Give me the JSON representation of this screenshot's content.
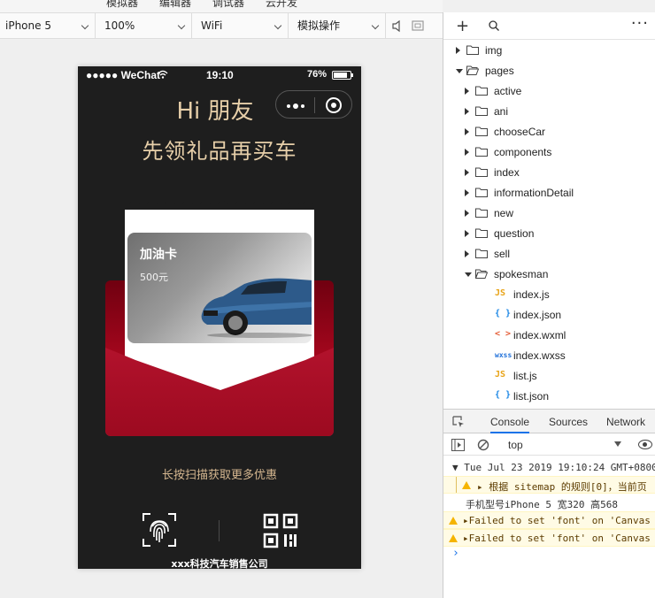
{
  "menu": [
    "模拟器",
    "编辑器",
    "调试器",
    "云开发"
  ],
  "toolbar": {
    "device": "iPhone 5",
    "zoom": "100%",
    "network": "WiFi",
    "operation": "模拟操作"
  },
  "phone": {
    "carrier": "●●●●● WeChat",
    "time": "19:10",
    "battery": "76%",
    "greeting": "Hi 朋友",
    "slogan": "先领礼品再买车",
    "card_title": "加油卡",
    "card_value": "500元",
    "hint": "长按扫描获取更多优惠",
    "company": "xxx科技汽车销售公司"
  },
  "tree": [
    {
      "label": "img",
      "type": "folder",
      "open": false,
      "level": 0
    },
    {
      "label": "pages",
      "type": "folder",
      "open": true,
      "level": 0
    },
    {
      "label": "active",
      "type": "folder",
      "open": false,
      "level": 1
    },
    {
      "label": "ani",
      "type": "folder",
      "open": false,
      "level": 1
    },
    {
      "label": "chooseCar",
      "type": "folder",
      "open": false,
      "level": 1
    },
    {
      "label": "components",
      "type": "folder",
      "open": false,
      "level": 1
    },
    {
      "label": "index",
      "type": "folder",
      "open": false,
      "level": 1
    },
    {
      "label": "informationDetail",
      "type": "folder",
      "open": false,
      "level": 1
    },
    {
      "label": "new",
      "type": "folder",
      "open": false,
      "level": 1
    },
    {
      "label": "question",
      "type": "folder",
      "open": false,
      "level": 1
    },
    {
      "label": "sell",
      "type": "folder",
      "open": false,
      "level": 1
    },
    {
      "label": "spokesman",
      "type": "folder",
      "open": true,
      "level": 1
    },
    {
      "label": "index.js",
      "type": "js",
      "level": 2
    },
    {
      "label": "index.json",
      "type": "json",
      "level": 2
    },
    {
      "label": "index.wxml",
      "type": "wxml",
      "level": 2
    },
    {
      "label": "index.wxss",
      "type": "wxss",
      "level": 2
    },
    {
      "label": "list.js",
      "type": "js",
      "level": 2
    },
    {
      "label": "list.json",
      "type": "json",
      "level": 2
    }
  ],
  "icon_text": {
    "js": "JS",
    "json": "{ }",
    "wxml": "< >",
    "wxss": "wxss"
  },
  "console": {
    "tabs": [
      "Console",
      "Sources",
      "Network"
    ],
    "context": "top",
    "logs": [
      {
        "type": "group",
        "text": "▼ Tue Jul 23 2019 19:10:24 GMT+0800"
      },
      {
        "type": "warn",
        "text": "▸ 根据 sitemap 的规则[0]，当前页"
      },
      {
        "type": "info",
        "text": "手机型号iPhone 5 宽320 高568"
      },
      {
        "type": "warn",
        "text": "▸Failed to set 'font' on 'Canvas"
      },
      {
        "type": "warn",
        "text": "▸Failed to set 'font' on 'Canvas"
      }
    ],
    "prompt": "›"
  }
}
